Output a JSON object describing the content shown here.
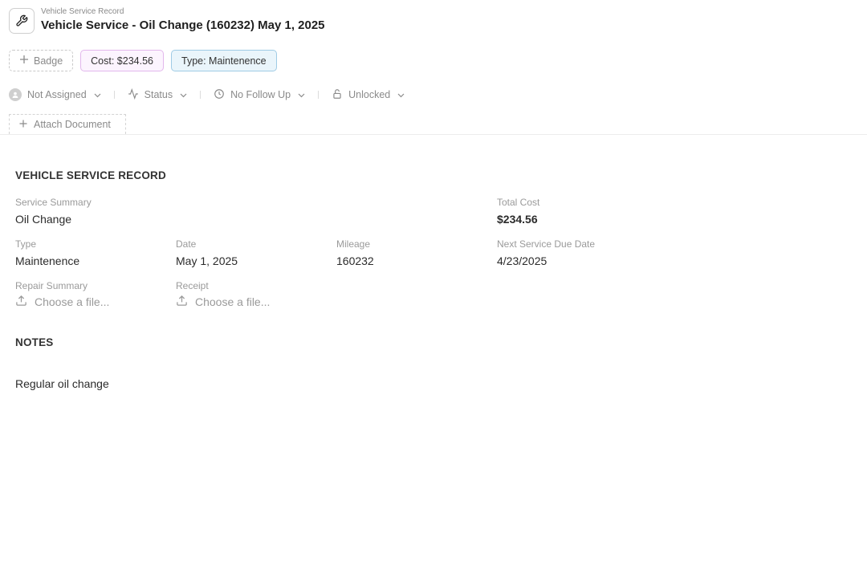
{
  "header": {
    "breadcrumb": "Vehicle Service Record",
    "title": "Vehicle Service - Oil Change (160232) May 1, 2025",
    "icon": "wrench-icon"
  },
  "badges": {
    "add_label": "Badge",
    "cost_label": "Cost: $234.56",
    "type_label": "Type: Maintenence"
  },
  "properties": {
    "assignee": "Not Assigned",
    "status": "Status",
    "follow_up": "No Follow Up",
    "lock": "Unlocked"
  },
  "attach": {
    "label": "Attach Document"
  },
  "record": {
    "section_title": "VEHICLE SERVICE RECORD",
    "service_summary": {
      "label": "Service Summary",
      "value": "Oil Change"
    },
    "total_cost": {
      "label": "Total Cost",
      "value": "$234.56"
    },
    "type": {
      "label": "Type",
      "value": "Maintenence"
    },
    "date": {
      "label": "Date",
      "value": "May 1, 2025"
    },
    "mileage": {
      "label": "Mileage",
      "value": "160232"
    },
    "next_service": {
      "label": "Next Service Due Date",
      "value": "4/23/2025"
    },
    "repair_summary": {
      "label": "Repair Summary",
      "placeholder": "Choose a file..."
    },
    "receipt": {
      "label": "Receipt",
      "placeholder": "Choose a file..."
    }
  },
  "notes": {
    "section_title": "NOTES",
    "text": "Regular oil change"
  }
}
